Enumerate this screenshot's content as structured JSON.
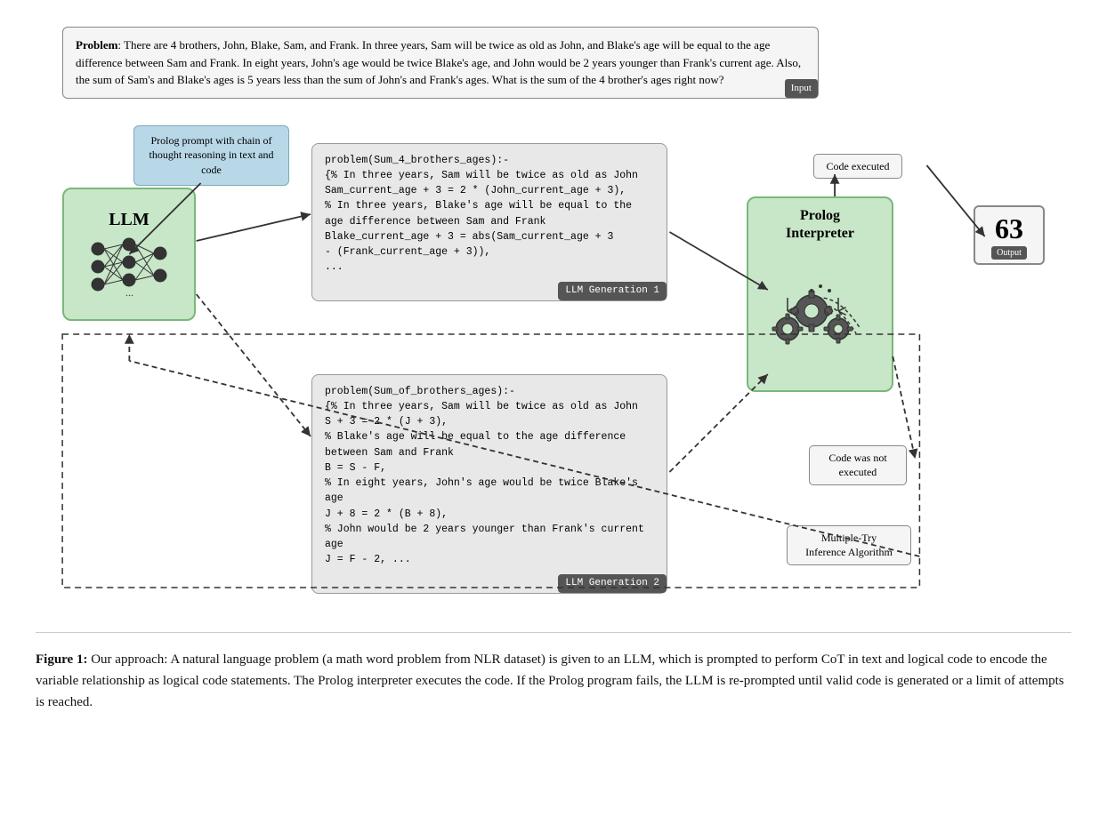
{
  "problem": {
    "text_bold": "Problem",
    "text_body": ": There are 4 brothers, John, Blake, Sam, and Frank. In three years, Sam will be twice as old as John, and Blake's age will be equal to the age difference between Sam and Frank. In eight years, John's age would be twice Blake's age, and John would be 2 years younger than Frank's current age. Also, the sum of Sam's and Blake's ages is 5 years less than the sum of John's and Frank's ages. What is the sum of the 4 brother's ages right now?",
    "input_badge": "Input"
  },
  "prolog_prompt": {
    "text": "Prolog prompt with chain of thought reasoning in text and code"
  },
  "llm": {
    "title": "LLM"
  },
  "code_box_1": {
    "lines": [
      "problem(Sum_4_brothers_ages):-",
      "{% In three years, Sam will be twice as old as John",
      "Sam_current_age + 3 = 2 * (John_current_age + 3),",
      "% In three years, Blake's age will be equal to the",
      "age difference between Sam and Frank",
      "Blake_current_age + 3 = abs(Sam_current_age + 3",
      "- (Frank_current_age + 3)),",
      "..."
    ],
    "badge": "LLM Generation 1"
  },
  "code_box_2": {
    "lines": [
      "problem(Sum_of_brothers_ages):-",
      "{% In three years, Sam will be twice as old as John",
      "S + 3 = 2 * (J + 3),",
      "% Blake's age will be equal to the age difference",
      "between Sam and Frank",
      "B = S - F,",
      "% In eight years, John's age would be twice Blake's age",
      "J + 8 = 2 * (B + 8),",
      "% John would be 2 years younger than Frank's current",
      "age",
      "J = F - 2, ..."
    ],
    "badge": "LLM Generation 2"
  },
  "prolog_interpreter": {
    "title": "Prolog\nInterpreter"
  },
  "output": {
    "number": "63",
    "badge": "Output"
  },
  "labels": {
    "code_executed": "Code executed",
    "code_not_executed": "Code was not\nexecuted",
    "multiple_try": "Multiple-Try\nInference Algorithm"
  },
  "caption": {
    "label": "Figure 1:",
    "text": " Our approach: A natural language problem (a math word problem from NLR dataset) is given to an LLM, which is prompted to perform CoT in text and logical code to encode the variable relationship as logical code statements.  The Prolog interpreter executes the code.  If the Prolog program fails, the LLM is re-prompted until valid code is generated or a limit of attempts is reached."
  }
}
